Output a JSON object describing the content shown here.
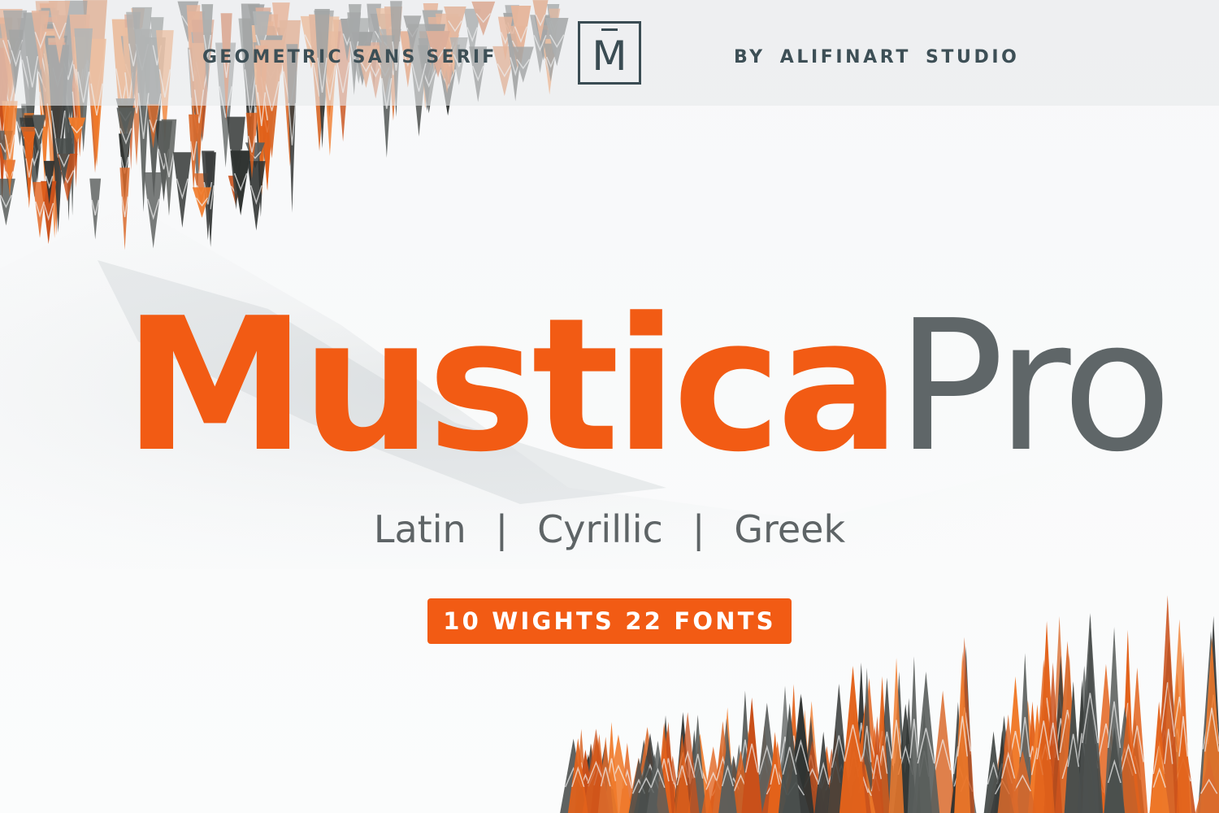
{
  "header": {
    "left_text": "GEOMETRIC SANS SERIF",
    "logo_letter": "M",
    "right_by": "BY",
    "right_studio_name": "ALIFINART",
    "right_studio_word": "STUDIO"
  },
  "title": {
    "main": "Mustica",
    "sub": "Pro"
  },
  "scripts": {
    "items": [
      "Latin",
      "Cyrillic",
      "Greek"
    ],
    "separator": "|"
  },
  "badge": {
    "label": "10 WIGHTS 22 FONTS"
  },
  "colors": {
    "accent": "#f25b14",
    "header_text": "#3d4f56",
    "subtitle": "#5f6668"
  }
}
